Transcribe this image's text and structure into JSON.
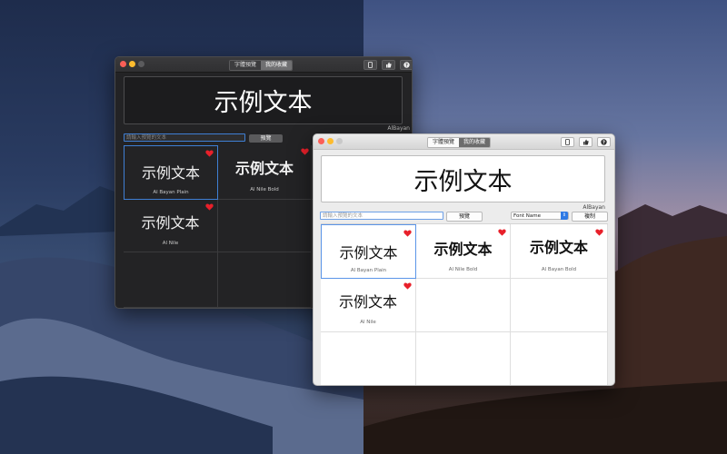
{
  "colors": {
    "selection_blue": "#3f7fd4",
    "heart_red": "#e8202a",
    "traffic_close": "#fc5f57",
    "traffic_minimize": "#fdbc2e"
  },
  "dark_window": {
    "tabs": [
      "字體預覽",
      "我的收藏"
    ],
    "selected_tab": "我的收藏",
    "toolbar_icons": [
      "phone-icon",
      "thumbs-up-icon",
      "help-icon"
    ],
    "preview_text": "示例文本",
    "font_name": "AlBayan",
    "input_placeholder": "請輸入預覽的文本",
    "preview_button": "預覽",
    "cards": [
      {
        "sample": "示例文本",
        "name": "Al Bayan Plain",
        "favorite": true,
        "selected": true,
        "bold": false
      },
      {
        "sample": "示例文本",
        "name": "Al Nile Bold",
        "favorite": true,
        "selected": false,
        "bold": true
      },
      {
        "sample": "示例文本",
        "name": "Al Nile",
        "favorite": true,
        "selected": false,
        "bold": false
      }
    ]
  },
  "light_window": {
    "tabs": [
      "字體預覽",
      "我的收藏"
    ],
    "selected_tab": "我的收藏",
    "toolbar_icons": [
      "phone-icon",
      "thumbs-up-icon",
      "help-icon"
    ],
    "preview_text": "示例文本",
    "font_name": "AlBayan",
    "input_placeholder": "請輸入預覽的文本",
    "preview_button": "預覽",
    "sort_select": "Font Name",
    "copy_button": "複制",
    "cards": [
      {
        "sample": "示例文本",
        "name": "Al Bayan Plain",
        "favorite": true,
        "selected": true,
        "bold": false
      },
      {
        "sample": "示例文本",
        "name": "Al Nile Bold",
        "favorite": true,
        "selected": false,
        "bold": true
      },
      {
        "sample": "示例文本",
        "name": "Al Bayan Bold",
        "favorite": true,
        "selected": false,
        "bold": true
      },
      {
        "sample": "示例文本",
        "name": "Al Nile",
        "favorite": true,
        "selected": false,
        "bold": false
      }
    ]
  }
}
